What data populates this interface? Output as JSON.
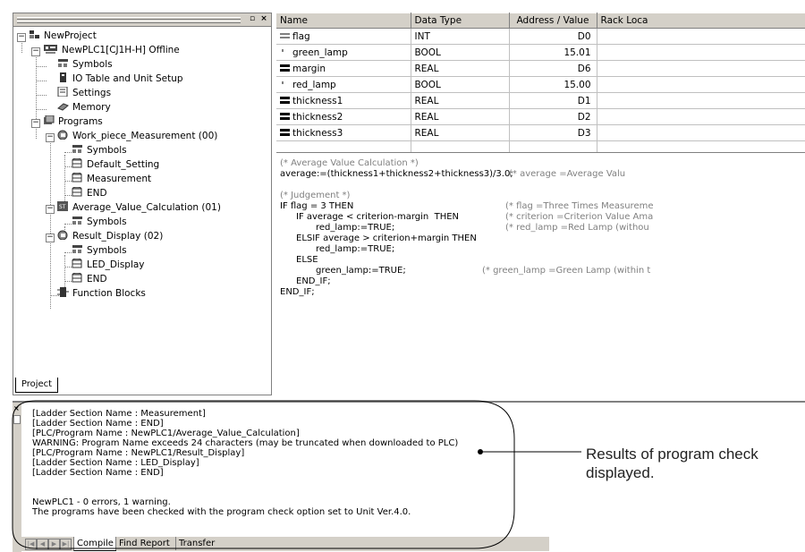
{
  "tree": {
    "items": [
      {
        "label": "NewProject"
      },
      {
        "label": "NewPLC1[CJ1H-H] Offline"
      },
      {
        "label": "Symbols"
      },
      {
        "label": "IO Table and Unit Setup"
      },
      {
        "label": "Settings"
      },
      {
        "label": "Memory"
      },
      {
        "label": "Programs"
      },
      {
        "label": "Work_piece_Measurement (00)"
      },
      {
        "label": "Symbols"
      },
      {
        "label": "Default_Setting"
      },
      {
        "label": "Measurement"
      },
      {
        "label": "END"
      },
      {
        "label": "Average_Value_Calculation (01)"
      },
      {
        "label": "Symbols"
      },
      {
        "label": "Result_Display (02)"
      },
      {
        "label": "Symbols"
      },
      {
        "label": "LED_Display"
      },
      {
        "label": "END"
      },
      {
        "label": "Function Blocks"
      }
    ],
    "tab_label": "Project"
  },
  "symbols": {
    "headers": [
      "Name",
      "Data Type",
      "Address / Value",
      "Rack Loca"
    ],
    "rows": [
      {
        "name": "flag",
        "type": "INT",
        "addr": "D0"
      },
      {
        "name": "green_lamp",
        "type": "BOOL",
        "addr": "15.01"
      },
      {
        "name": "margin",
        "type": "REAL",
        "addr": "D6"
      },
      {
        "name": "red_lamp",
        "type": "BOOL",
        "addr": "15.00"
      },
      {
        "name": "thickness1",
        "type": "REAL",
        "addr": "D1"
      },
      {
        "name": "thickness2",
        "type": "REAL",
        "addr": "D2"
      },
      {
        "name": "thickness3",
        "type": "REAL",
        "addr": "D3"
      }
    ]
  },
  "code": {
    "l1": "(* Average Value Calculation *)",
    "l2a": "average:=(thickness1+thickness2+thickness3)/3.0;",
    "l2b": "(* average =Average Valu",
    "l3": "(* Judgement *)",
    "l4a": "IF flag = 3 THEN",
    "l4b": "(* flag =Three Times Measureme",
    "l5a": "IF average < criterion-margin  THEN",
    "l5b": "(* criterion =Criterion Value Ama",
    "l6a": "red_lamp:=TRUE;",
    "l6b": "(* red_lamp =Red Lamp (withou",
    "l7": "ELSIF average > criterion+margin THEN",
    "l8": "red_lamp:=TRUE;",
    "l9": "ELSE",
    "l10a": "green_lamp:=TRUE;",
    "l10b": "(* green_lamp =Green Lamp (within t",
    "l11": "END_IF;",
    "l12": "END_IF;"
  },
  "output": {
    "lines": [
      "[Ladder Section Name : Measurement]",
      "[Ladder Section Name : END]",
      "[PLC/Program Name : NewPLC1/Average_Value_Calculation]",
      "WARNING: Program Name exceeds 24 characters (may be truncated when downloaded to PLC)",
      "[PLC/Program Name : NewPLC1/Result_Display]",
      "[Ladder Section Name : LED_Display]",
      "[Ladder Section Name : END]",
      "",
      "NewPLC1 - 0 errors, 1 warning.",
      "The programs have been checked with the program check option set to Unit Ver.4.0."
    ],
    "tabs": [
      "Compile",
      "Find Report",
      "Transfer"
    ]
  },
  "callout": {
    "text": "Results of program check displayed."
  }
}
